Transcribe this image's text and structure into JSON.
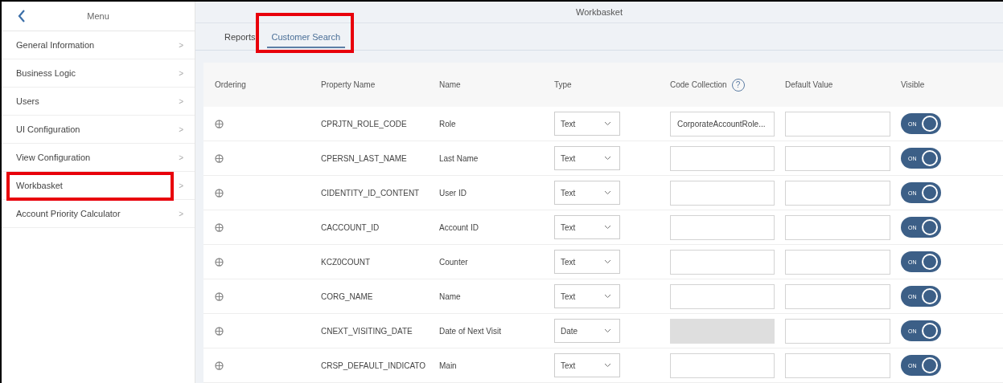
{
  "sidebar": {
    "title": "Menu",
    "items": [
      {
        "label": "General Information",
        "highlighted": false,
        "chevron": ">"
      },
      {
        "label": "Business Logic",
        "highlighted": false,
        "chevron": ">"
      },
      {
        "label": "Users",
        "highlighted": false,
        "chevron": ">"
      },
      {
        "label": "UI Configuration",
        "highlighted": false,
        "chevron": ">"
      },
      {
        "label": "View Configuration",
        "highlighted": false,
        "chevron": ">"
      },
      {
        "label": "Workbasket",
        "highlighted": true,
        "chevron": ">"
      },
      {
        "label": "Account Priority Calculator",
        "highlighted": false,
        "chevron": ">"
      }
    ]
  },
  "header": {
    "title": "Workbasket"
  },
  "tabs": [
    {
      "label": "Reports",
      "selected": false,
      "highlighted": false
    },
    {
      "label": "Customer Search",
      "selected": true,
      "highlighted": true
    }
  ],
  "table": {
    "columns": [
      "Ordering",
      "Property Name",
      "Name",
      "Type",
      "Code Collection",
      "Default Value",
      "Visible"
    ],
    "help_icon_glyph": "?",
    "rows": [
      {
        "property": "CPRJTN_ROLE_CODE",
        "name": "Role",
        "type": "Text",
        "code_collection": "CorporateAccountRole...",
        "code_collection_disabled": false,
        "visible": true,
        "toggle_label": "ON"
      },
      {
        "property": "CPERSN_LAST_NAME",
        "name": "Last Name",
        "type": "Text",
        "code_collection_disabled": false,
        "visible": true,
        "toggle_label": "ON"
      },
      {
        "property": "CIDENTITY_ID_CONTENT",
        "name": "User ID",
        "type": "Text",
        "code_collection_disabled": false,
        "visible": true,
        "toggle_label": "ON"
      },
      {
        "property": "CACCOUNT_ID",
        "name": "Account ID",
        "type": "Text",
        "code_collection_disabled": false,
        "visible": true,
        "toggle_label": "ON"
      },
      {
        "property": "KCZ0COUNT",
        "name": "Counter",
        "type": "Text",
        "code_collection_disabled": false,
        "visible": true,
        "toggle_label": "ON"
      },
      {
        "property": "CORG_NAME",
        "name": "Name",
        "type": "Text",
        "code_collection_disabled": false,
        "visible": true,
        "toggle_label": "ON"
      },
      {
        "property": "CNEXT_VISITING_DATE",
        "name": "Date of Next Visit",
        "type": "Date",
        "code_collection_disabled": true,
        "visible": true,
        "toggle_label": "ON"
      },
      {
        "property": "CRSP_DEFAULT_INDICATO",
        "name": "Main",
        "type": "Text",
        "code_collection_disabled": false,
        "visible": true,
        "toggle_label": "ON"
      }
    ]
  }
}
